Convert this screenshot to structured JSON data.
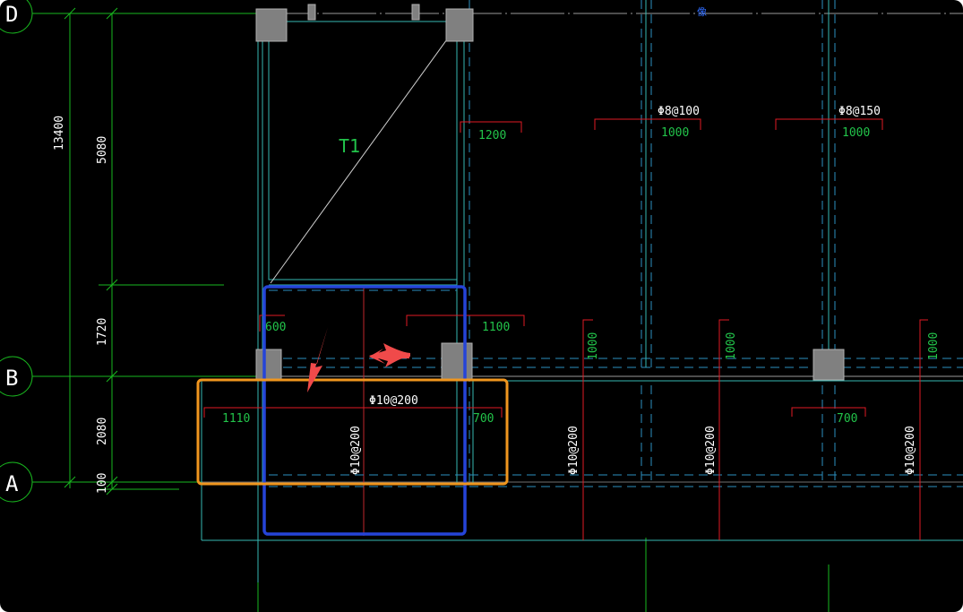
{
  "app": {
    "title": "CAD drawing - slab reinforcement plan"
  },
  "colors": {
    "background": "#000000",
    "grid_green": "#19b81f",
    "cyan_outline": "#36b7b2",
    "red_rebar": "#e01a24",
    "dashed_beam": "#2b8fbf",
    "column_fill": "#808080",
    "text_white": "#ffffff",
    "text_green": "#22c34a",
    "highlight_blue": "#2544d8",
    "highlight_orange": "#f0961e",
    "arrow_red": "#f04a4a"
  },
  "axes": {
    "D": "D",
    "B": "B",
    "A": "A"
  },
  "dimensions": {
    "total": "13400",
    "d_to_upper": "5080",
    "upper_to_b": "1720",
    "b_to_a": "2080",
    "offset_a": "100"
  },
  "labels": {
    "stair": "T1",
    "top_mark": "像",
    "rebar_1": "Φ8@100",
    "rebar_2": "Φ8@150",
    "rebar_main": "Φ10@200",
    "rebar_v1": "Φ10@200",
    "rebar_v2": "Φ10@200",
    "rebar_v3": "Φ10@200",
    "rebar_v4": "Φ10@200",
    "len_1200": "1200",
    "len_1000_a": "1000",
    "len_1000_b": "1000",
    "len_600": "600",
    "len_1100": "1100",
    "len_1000_v1": "1000",
    "len_1000_v2": "1000",
    "len_1000_v3": "1000",
    "len_1110": "1110",
    "len_700_a": "700",
    "len_700_b": "700"
  }
}
